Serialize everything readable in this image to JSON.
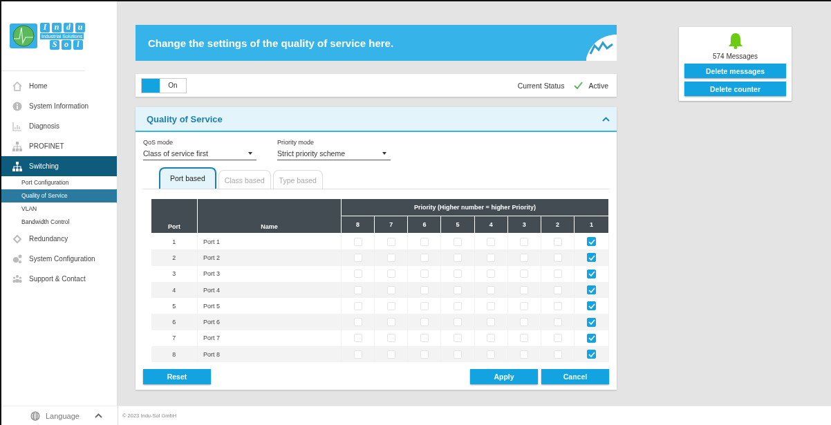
{
  "logo": {
    "letters_top": [
      "I",
      "n",
      "d",
      "u"
    ],
    "tagline": "Industrial Solutions",
    "letters_bottom": [
      "S",
      "o",
      "l"
    ]
  },
  "nav": [
    {
      "label": "Home",
      "kind": "home",
      "selected": false
    },
    {
      "label": "System Information",
      "kind": "info",
      "selected": false
    },
    {
      "label": "Diagnosis",
      "kind": "chart",
      "selected": false
    },
    {
      "label": "PROFINET",
      "kind": "network",
      "selected": false
    },
    {
      "label": "Switching",
      "kind": "network",
      "selected": true,
      "children": [
        {
          "label": "Port Configuration",
          "selected": false
        },
        {
          "label": "Quality of Service",
          "selected": true
        },
        {
          "label": "VLAN",
          "selected": false
        },
        {
          "label": "Bandwidth Control",
          "selected": false
        }
      ]
    },
    {
      "label": "Redundancy",
      "kind": "ring",
      "selected": false
    },
    {
      "label": "System Configuration",
      "kind": "gears",
      "selected": false
    },
    {
      "label": "Support & Contact",
      "kind": "people",
      "selected": false
    }
  ],
  "banner": {
    "title": "Change the settings of the quality of service here."
  },
  "status": {
    "toggle_label": "On",
    "on": true,
    "label": "Current Status",
    "value": "Active"
  },
  "panel": {
    "title": "Quality of Service",
    "expanded": true,
    "selects": [
      {
        "label": "QoS mode",
        "value": "Class of service first"
      },
      {
        "label": "Priority mode",
        "value": "Strict priority scheme"
      }
    ],
    "tabs": [
      {
        "label": "Port based",
        "selected": true
      },
      {
        "label": "Class based",
        "selected": false
      },
      {
        "label": "Type based",
        "selected": false
      }
    ],
    "table": {
      "columns": [
        "Port",
        "Name"
      ],
      "group_header": "Priority (Higher number = higher Priority)",
      "priorities": [
        "8",
        "7",
        "6",
        "5",
        "4",
        "3",
        "2",
        "1"
      ],
      "rows": [
        {
          "port": "1",
          "name": "Port 1",
          "checks": [
            {
              "checked": false
            },
            {
              "checked": false
            },
            {
              "checked": false
            },
            {
              "checked": false
            },
            {
              "checked": false
            },
            {
              "checked": false
            },
            {
              "checked": false
            },
            {
              "checked": true
            }
          ]
        },
        {
          "port": "2",
          "name": "Port 2",
          "checks": [
            {
              "checked": false
            },
            {
              "checked": false
            },
            {
              "checked": false
            },
            {
              "checked": false
            },
            {
              "checked": false
            },
            {
              "checked": false
            },
            {
              "checked": false
            },
            {
              "checked": true
            }
          ]
        },
        {
          "port": "3",
          "name": "Port 3",
          "checks": [
            {
              "checked": false
            },
            {
              "checked": false
            },
            {
              "checked": false
            },
            {
              "checked": false
            },
            {
              "checked": false
            },
            {
              "checked": false
            },
            {
              "checked": false
            },
            {
              "checked": true
            }
          ]
        },
        {
          "port": "4",
          "name": "Port 4",
          "checks": [
            {
              "checked": false
            },
            {
              "checked": false
            },
            {
              "checked": false
            },
            {
              "checked": false
            },
            {
              "checked": false
            },
            {
              "checked": false
            },
            {
              "checked": false
            },
            {
              "checked": true
            }
          ]
        },
        {
          "port": "5",
          "name": "Port 5",
          "checks": [
            {
              "checked": false
            },
            {
              "checked": false
            },
            {
              "checked": false
            },
            {
              "checked": false
            },
            {
              "checked": false
            },
            {
              "checked": false
            },
            {
              "checked": false
            },
            {
              "checked": true
            }
          ]
        },
        {
          "port": "6",
          "name": "Port 6",
          "checks": [
            {
              "checked": false
            },
            {
              "checked": false
            },
            {
              "checked": false
            },
            {
              "checked": false
            },
            {
              "checked": false
            },
            {
              "checked": false
            },
            {
              "checked": false
            },
            {
              "checked": true
            }
          ]
        },
        {
          "port": "7",
          "name": "Port 7",
          "checks": [
            {
              "checked": false
            },
            {
              "checked": false
            },
            {
              "checked": false
            },
            {
              "checked": false
            },
            {
              "checked": false
            },
            {
              "checked": false
            },
            {
              "checked": false
            },
            {
              "checked": true
            }
          ]
        },
        {
          "port": "8",
          "name": "Port 8",
          "checks": [
            {
              "checked": false
            },
            {
              "checked": false
            },
            {
              "checked": false
            },
            {
              "checked": false
            },
            {
              "checked": false
            },
            {
              "checked": false
            },
            {
              "checked": false
            },
            {
              "checked": true
            }
          ]
        }
      ]
    },
    "buttons": {
      "reset": "Reset",
      "apply": "Apply",
      "cancel": "Cancel"
    }
  },
  "messages": {
    "count": "574 Messages",
    "buttons": [
      "Delete messages",
      "Delete counter"
    ]
  },
  "footer": {
    "language": "Language",
    "copyright": "© 2023 Indu-Sol GmbH"
  }
}
